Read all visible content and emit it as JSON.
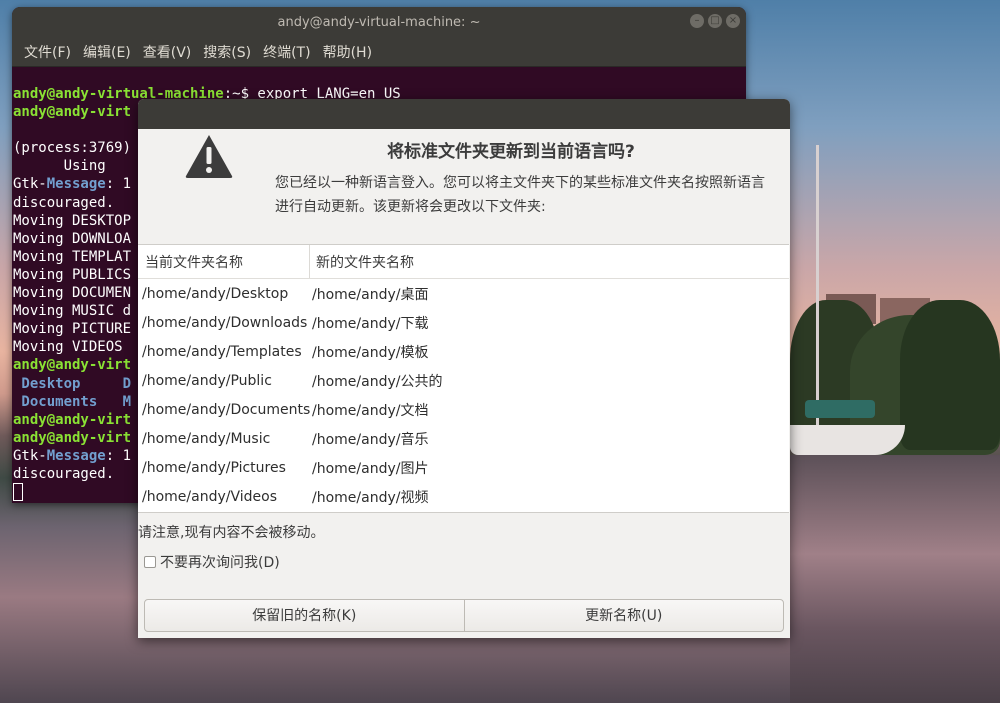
{
  "terminal": {
    "title": "andy@andy-virtual-machine: ~",
    "menu": [
      "文件(F)",
      "编辑(E)",
      "查看(V)",
      "搜索(S)",
      "终端(T)",
      "帮助(H)"
    ],
    "lines": {
      "l1_prompt": "andy@andy-virtual-machine",
      "l1_rest": ":~$ export LANG=en_US",
      "l2_prompt": "andy@andy-virt",
      "l4": "(process:3769)",
      "l5": "      Using",
      "l6_a": "Gtk-",
      "l6_b": "Message",
      "l6_c": ": 1",
      "l7": "discouraged.",
      "l8": "Moving DESKTOP",
      "l9": "Moving DOWNLOA",
      "l10": "Moving TEMPLAT",
      "l11": "Moving PUBLICS",
      "l12": "Moving DOCUMEN",
      "l13": "Moving MUSIC d",
      "l14": "Moving PICTURE",
      "l15": "Moving VIDEOS",
      "l16_prompt": "andy@andy-virt",
      "l17_a": " Desktop",
      "l17_b": "D",
      "l18_a": " Documents",
      "l18_b": "M",
      "l19_prompt": "andy@andy-virt",
      "l20_prompt": "andy@andy-virt",
      "l21_a": "Gtk-",
      "l21_b": "Message",
      "l21_c": ": 1",
      "l22": "discouraged."
    }
  },
  "dialog": {
    "heading": "将标准文件夹更新到当前语言吗?",
    "description": "您已经以一种新语言登入。您可以将主文件夹下的某些标准文件夹名按照新语言进行自动更新。该更新将会更改以下文件夹:",
    "columns": [
      "当前文件夹名称",
      "新的文件夹名称"
    ],
    "rows": [
      [
        "/home/andy/Desktop",
        "/home/andy/桌面"
      ],
      [
        "/home/andy/Downloads",
        "/home/andy/下载"
      ],
      [
        "/home/andy/Templates",
        "/home/andy/模板"
      ],
      [
        "/home/andy/Public",
        "/home/andy/公共的"
      ],
      [
        "/home/andy/Documents",
        "/home/andy/文档"
      ],
      [
        "/home/andy/Music",
        "/home/andy/音乐"
      ],
      [
        "/home/andy/Pictures",
        "/home/andy/图片"
      ],
      [
        "/home/andy/Videos",
        "/home/andy/视频"
      ]
    ],
    "note": "请注意,现有内容不会被移动。",
    "dont_ask": "不要再次询问我(D)",
    "keep_button": "保留旧的名称(K)",
    "update_button": "更新名称(U)"
  },
  "colors": {
    "terminal_bg": "#300a24",
    "prompt_green": "#8ae234",
    "dir_blue": "#729fcf",
    "titlebar": "#3c3b37"
  }
}
